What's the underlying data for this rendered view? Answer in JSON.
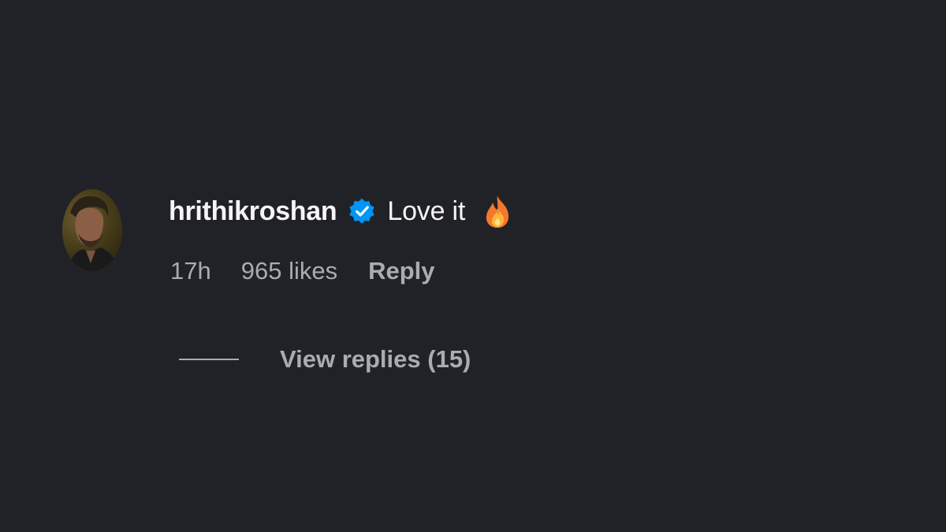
{
  "comment": {
    "username": "hrithikroshan",
    "verified_icon": "verified-badge-icon",
    "text": "Love it",
    "emoji_icon": "fire-emoji-icon",
    "time": "17h",
    "likes": "965 likes",
    "reply_label": "Reply",
    "view_replies_label": "View replies (15)"
  },
  "colors": {
    "background": "#212227",
    "primary_text": "#f5f5f5",
    "secondary_text": "#a8acb3",
    "verified": "#0095f6"
  }
}
